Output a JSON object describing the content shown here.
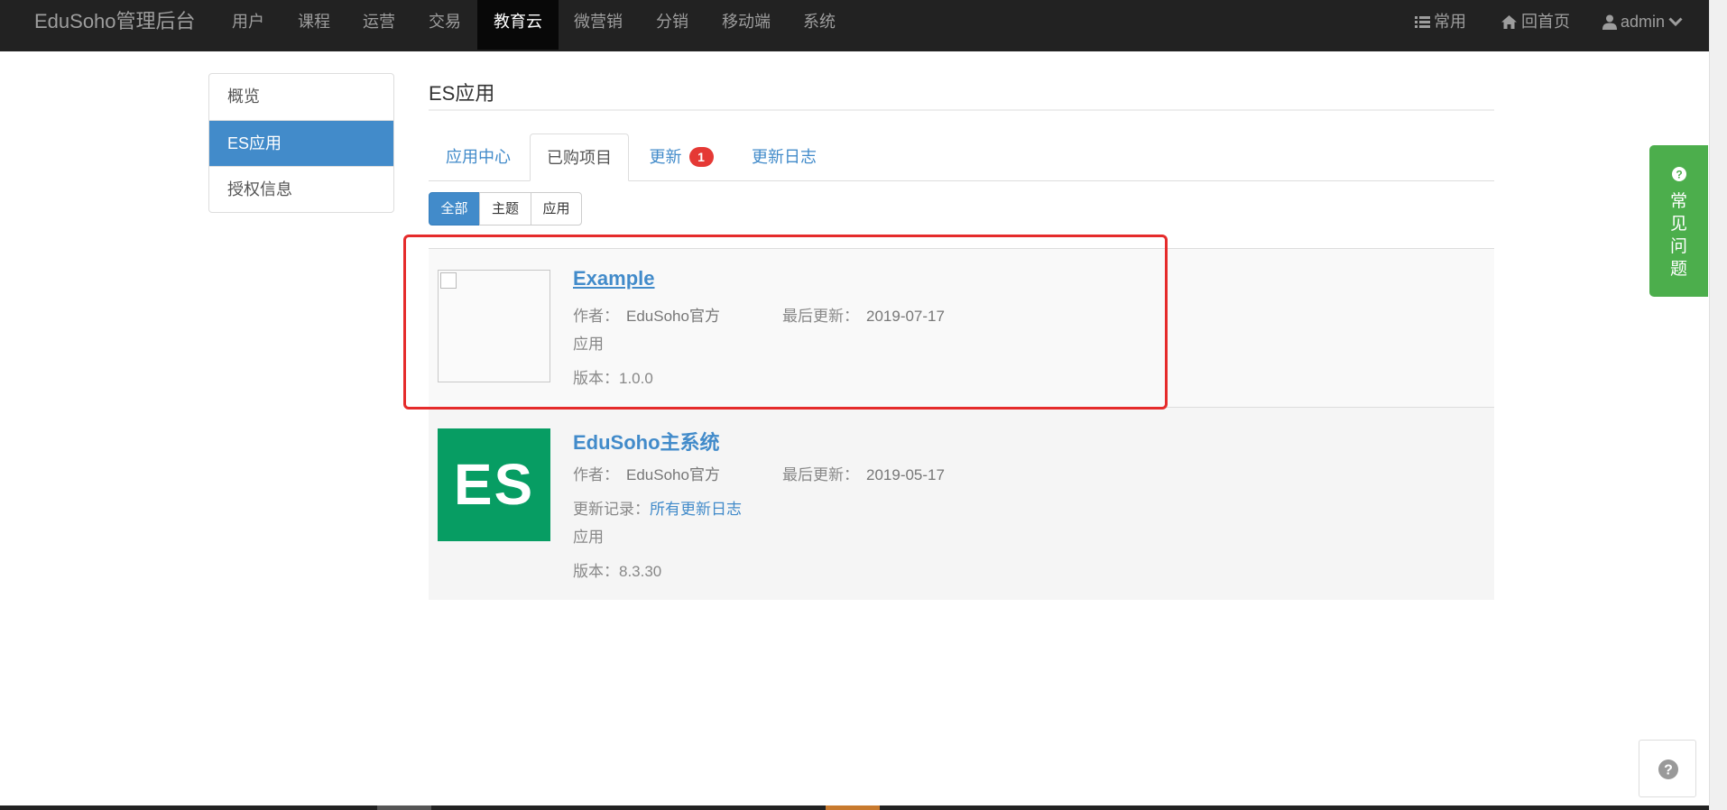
{
  "navbar": {
    "brand": "EduSoho管理后台",
    "items": [
      {
        "label": "用户",
        "active": false
      },
      {
        "label": "课程",
        "active": false
      },
      {
        "label": "运营",
        "active": false
      },
      {
        "label": "交易",
        "active": false
      },
      {
        "label": "教育云",
        "active": true
      },
      {
        "label": "微营销",
        "active": false
      },
      {
        "label": "分销",
        "active": false
      },
      {
        "label": "移动端",
        "active": false
      },
      {
        "label": "系统",
        "active": false
      }
    ],
    "right": {
      "common_label": "常用",
      "home_label": "回首页",
      "user_label": "admin"
    }
  },
  "sidebar": {
    "items": [
      {
        "label": "概览",
        "active": false
      },
      {
        "label": "ES应用",
        "active": true
      },
      {
        "label": "授权信息",
        "active": false
      }
    ]
  },
  "main": {
    "title": "ES应用",
    "tabs": [
      {
        "label": "应用中心",
        "active": false
      },
      {
        "label": "已购项目",
        "active": true
      },
      {
        "label": "更新",
        "active": false,
        "badge": "1"
      },
      {
        "label": "更新日志",
        "active": false
      }
    ],
    "filters": [
      {
        "label": "全部",
        "active": true
      },
      {
        "label": "主题",
        "active": false
      },
      {
        "label": "应用",
        "active": false
      }
    ],
    "apps": [
      {
        "name": "Example",
        "author_label": "作者：",
        "author": "EduSoho官方",
        "updated_label": "最后更新：",
        "updated": "2019-07-17",
        "type": "应用",
        "version_label": "版本：",
        "version": "1.0.0"
      },
      {
        "name": "EduSoho主系统",
        "logo_text": "ES",
        "author_label": "作者：",
        "author": "EduSoho官方",
        "updated_label": "最后更新：",
        "updated": "2019-05-17",
        "changelog_label": "更新记录：",
        "changelog_link": "所有更新日志",
        "type": "应用",
        "version_label": "版本：",
        "version": "8.3.30"
      }
    ]
  },
  "faq": {
    "chars": [
      "常",
      "见",
      "问",
      "题"
    ]
  },
  "colors": {
    "navbar_bg": "#222222",
    "primary": "#428bca",
    "highlight": "#e52b2b",
    "faq_green": "#4cae4c",
    "es_green": "#079d63",
    "badge_red": "#e53935"
  },
  "icons": [
    "list-icon",
    "home-icon",
    "user-icon",
    "chevron-down-icon",
    "question-circle-icon"
  ]
}
